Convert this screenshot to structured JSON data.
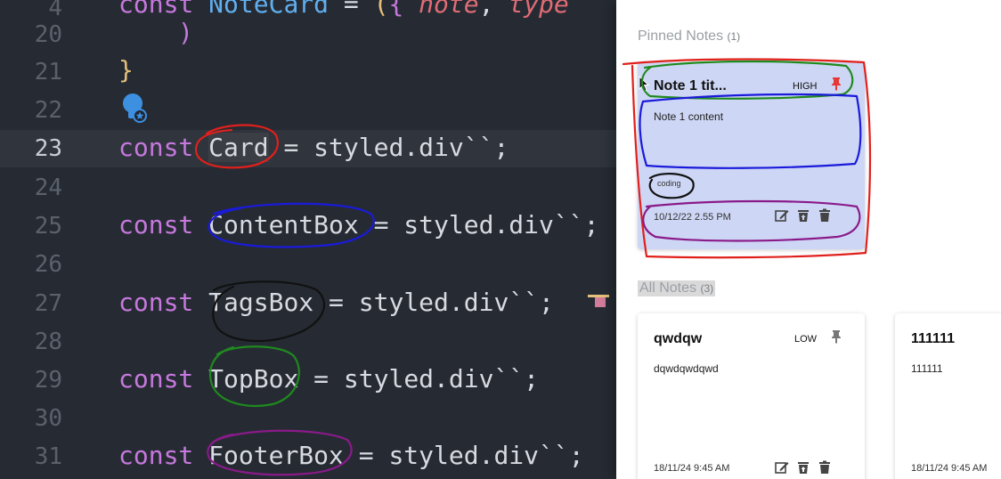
{
  "editor": {
    "lines": [
      {
        "num": "4"
      },
      {
        "num": "20",
        "close_paren": ")"
      },
      {
        "num": "21",
        "close_brace": "}"
      },
      {
        "num": "22"
      },
      {
        "num": "23"
      },
      {
        "num": "24"
      },
      {
        "num": "25"
      },
      {
        "num": "26"
      },
      {
        "num": "27"
      },
      {
        "num": "28"
      },
      {
        "num": "29"
      },
      {
        "num": "30"
      },
      {
        "num": "31"
      }
    ],
    "line4": {
      "kw": "const",
      "name": "NoteCard",
      "eq": " = ",
      "paren": "(",
      "brace": "{ ",
      "p1": "note",
      "comma": ", ",
      "p2": "type"
    },
    "decls": [
      {
        "kw": "const",
        "name": "Card",
        "rest": " = styled.div``;"
      },
      {
        "kw": "const",
        "name": "ContentBox",
        "rest": " = styled.div``;"
      },
      {
        "kw": "const",
        "name": "TagsBox",
        "rest": " = styled.div``;"
      },
      {
        "kw": "const",
        "name": "TopBox",
        "rest": " = styled.div``;"
      },
      {
        "kw": "const",
        "name": "FooterBox",
        "rest": " = styled.div``;"
      }
    ]
  },
  "app": {
    "pinned": {
      "label": "Pinned Notes",
      "count": "(1)"
    },
    "all": {
      "label": "All Notes",
      "count": "(3)"
    },
    "notes": [
      {
        "title": "Note 1 tit...",
        "priority": "HIGH",
        "content": "Note 1 content",
        "tag": "coding",
        "date": "10/12/22 2.55 PM"
      },
      {
        "title": "qwdqw",
        "priority": "LOW",
        "content": "dqwdqwdqwd",
        "date": "18/11/24 9:45 AM"
      },
      {
        "title": "111111",
        "content": "111111",
        "date": "18/11/24 9:45 AM"
      }
    ]
  },
  "colors": {
    "editor_bg": "#262b33",
    "pinned_card_bg": "#cdd6f4",
    "pin_active": "#e53935",
    "annot_red": "#e0201c",
    "annot_blue": "#1a1adb",
    "annot_black": "#111111",
    "annot_green": "#1f8a1f",
    "annot_purple": "#8a1a8a"
  },
  "icons": [
    "lightbulb-icon",
    "pin-icon",
    "edit-icon",
    "archive-icon",
    "delete-icon"
  ]
}
